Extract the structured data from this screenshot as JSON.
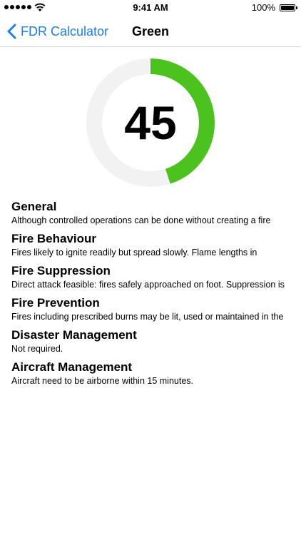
{
  "status_bar": {
    "time": "9:41 AM",
    "battery": "100%"
  },
  "nav": {
    "back_label": "FDR Calculator",
    "title": "Green"
  },
  "gauge": {
    "value": "45",
    "fraction": 0.45,
    "progress_color": "#4cc21e",
    "track_color": "#f2f2f2"
  },
  "sections": [
    {
      "title": "General",
      "text": "Although controlled operations can be done without creating a fire"
    },
    {
      "title": "Fire Behaviour",
      "text": "Fires likely to ignite readily but spread slowly. Flame lengths in"
    },
    {
      "title": "Fire Suppression",
      "text": "Direct attack feasible: fires safely approached on foot. Suppression is"
    },
    {
      "title": "Fire Prevention",
      "text": "Fires including prescribed burns may be lit, used or maintained in the"
    },
    {
      "title": "Disaster Management",
      "text": "Not required."
    },
    {
      "title": "Aircraft Management",
      "text": "Aircraft need to be airborne within 15 minutes."
    }
  ]
}
